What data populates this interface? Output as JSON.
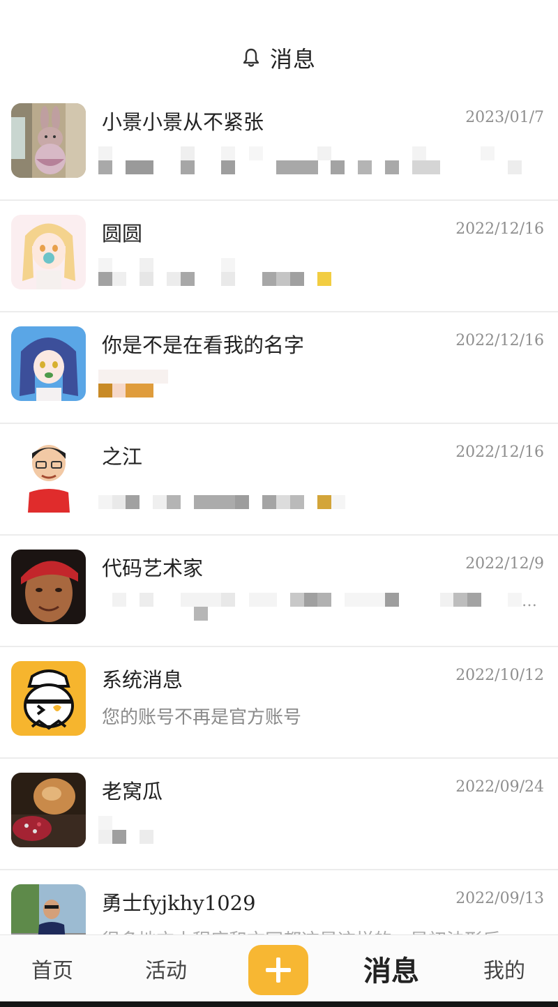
{
  "header": {
    "title": "消息",
    "icon": "bell-icon"
  },
  "messages": [
    {
      "name": "小景小景从不紧张",
      "date": "2023/01/7",
      "preview": "",
      "avatar": "bunny-avatar"
    },
    {
      "name": "圆圆",
      "date": "2022/12/16",
      "preview": "",
      "avatar": "anime-girl-blonde-avatar"
    },
    {
      "name": "你是不是在看我的名字",
      "date": "2022/12/16",
      "preview": "",
      "avatar": "anime-girl-blue-avatar"
    },
    {
      "name": "之江",
      "date": "2022/12/16",
      "preview": "",
      "avatar": "cartoon-man-avatar"
    },
    {
      "name": "代码艺术家",
      "date": "2022/12/9",
      "preview": "",
      "avatar": "bandana-man-avatar"
    },
    {
      "name": "系统消息",
      "date": "2022/10/12",
      "preview": "您的账号不再是官方账号",
      "avatar": "mascot-avatar"
    },
    {
      "name": "老窝瓜",
      "date": "2022/09/24",
      "preview": "",
      "avatar": "pomegranate-avatar"
    },
    {
      "name": "勇士fyjkhy1029",
      "date": "2022/09/13",
      "preview": "很多地方小程序和文网都这是这样的，是初法形后",
      "avatar": "man-suit-avatar"
    }
  ],
  "tabbar": {
    "home": "首页",
    "activity": "活动",
    "add_icon": "plus-icon",
    "messages": "消息",
    "mine": "我的"
  },
  "colors": {
    "accent": "#f7b733"
  }
}
